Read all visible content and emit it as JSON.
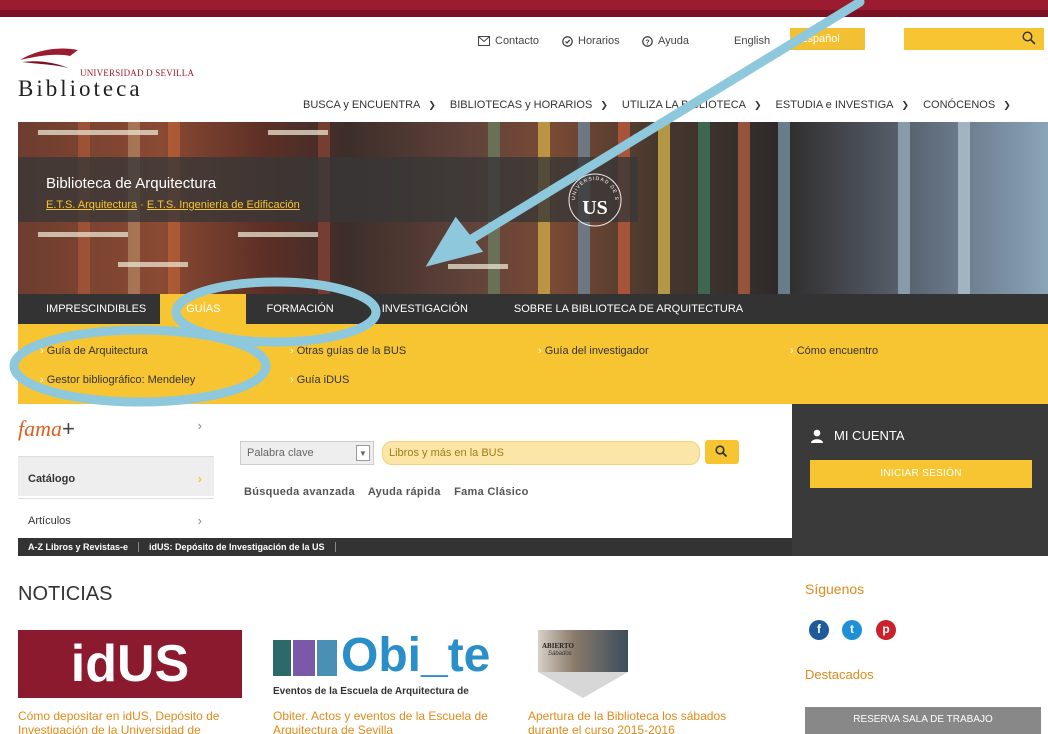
{
  "header": {
    "logo_univ": "UNIVERSIDAD D SEVILLA",
    "logo_title": "Biblioteca",
    "utility": {
      "contacto": "Contacto",
      "horarios": "Horarios",
      "ayuda": "Ayuda",
      "english": "English",
      "espanol": "Español"
    },
    "search_placeholder": "",
    "nav": [
      "BUSCA y ENCUENTRA",
      "BIBLIOTECAS y HORARIOS",
      "UTILIZA LA BIBLIOTECA",
      "ESTUDIA e INVESTIGA",
      "CONÓCENOS"
    ]
  },
  "hero": {
    "title": "Biblioteca de Arquitectura",
    "sub_a": "E.T.S. Arquitectura",
    "sub_sep": " · ",
    "sub_b": "E.T.S. Ingeniería de Edificación",
    "seal_text": "UNIVERSIDAD DE SEVILLA"
  },
  "tabs": [
    "IMPRESCINDIBLES",
    "GUÍAS",
    "FORMACIÓN",
    "INVESTIGACIÓN",
    "SOBRE LA BIBLIOTECA DE ARQUITECTURA"
  ],
  "subnav": {
    "guia_arq": "Guía de Arquitectura",
    "otras": "Otras guías de la BUS",
    "investigador": "Guía del investigador",
    "como": "Cómo encuentro",
    "mendeley": "Gestor bibliográfico: Mendeley",
    "idus": "Guía iDUS"
  },
  "fama": {
    "logo_a": "fama",
    "logo_b": "+",
    "catalogo": "Catálogo",
    "articulos": "Artículos",
    "select_value": "Palabra clave",
    "input_placeholder": "Libros y más en la BUS",
    "links": [
      "Búsqueda avanzada",
      "Ayuda rápida",
      "Fama Clásico"
    ],
    "bottom": [
      "A-Z Libros y Revistas-e",
      "idUS: Depósito de Investigación de la US"
    ]
  },
  "account": {
    "title": "MI CUENTA",
    "login": "INICIAR SESIÓN"
  },
  "news": {
    "heading": "NOTICIAS",
    "items": [
      {
        "title": "Cómo depositar en idUS, Depósito de Investigación de la Universidad de",
        "image_text": "idUS"
      },
      {
        "title": "Obiter. Actos y eventos de la Escuela de Arquitectura de Sevilla",
        "image_text": "Obi_te",
        "image_caption": "Eventos de la Escuela de Arquitectura de"
      },
      {
        "title": "Apertura de la Biblioteca los sábados durante el curso 2015-2016",
        "image_text": "ABIERTO",
        "image_caption": "Sábados"
      }
    ]
  },
  "sidebar": {
    "follow": "Síguenos",
    "destacados": "Destacados",
    "reserva": "RESERVA SALA DE TRABAJO",
    "social": [
      "facebook-icon",
      "twitter-icon",
      "pinterest-icon"
    ]
  },
  "colors": {
    "brand_red": "#9b1b30",
    "accent_yellow": "#f7c531",
    "orange_link": "#e08a1a",
    "dark": "#333333",
    "annotation_blue": "#8ec8dc"
  }
}
